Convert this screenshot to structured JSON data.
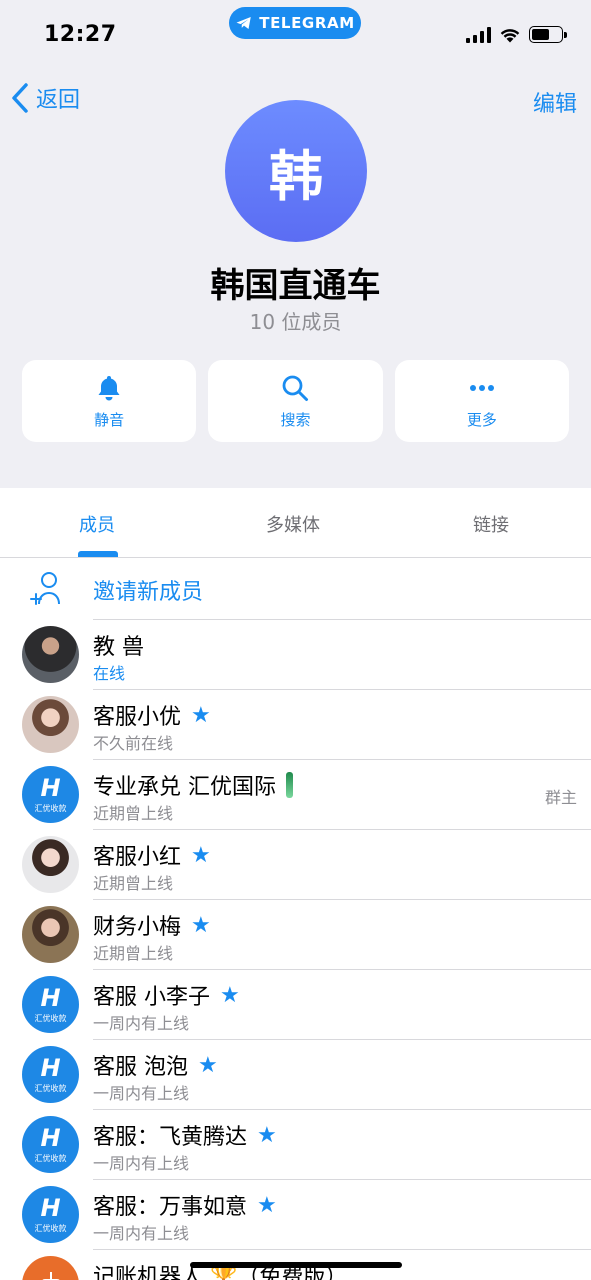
{
  "status": {
    "time": "12:27",
    "app_pill": "TELEGRAM"
  },
  "nav": {
    "back": "返回",
    "edit": "编辑"
  },
  "group": {
    "avatar_letter": "韩",
    "name": "韩国直通车",
    "members": "10 位成员"
  },
  "actions": [
    {
      "label": "静音",
      "icon": "bell-icon"
    },
    {
      "label": "搜索",
      "icon": "search-icon"
    },
    {
      "label": "更多",
      "icon": "more-icon"
    }
  ],
  "tabs": [
    "成员",
    "多媒体",
    "链接"
  ],
  "invite": "邀请新成员",
  "brand_avatar": {
    "letter": "H",
    "text": "汇优收款"
  },
  "members": [
    {
      "name": "教 兽",
      "status": "在线",
      "avatar": "photo-man"
    },
    {
      "name": "客服小优",
      "status": "不久前在线",
      "avatar": "photo-girl1"
    },
    {
      "name": "专业承兑 汇优国际",
      "status": "近期曾上线",
      "avatar": "brand",
      "role": "群主"
    },
    {
      "name": "客服小红",
      "status": "近期曾上线",
      "avatar": "photo-girl2"
    },
    {
      "name": "财务小梅",
      "status": "近期曾上线",
      "avatar": "photo-girl3"
    },
    {
      "name": "客服 小李子",
      "status": "一周内有上线",
      "avatar": "brand"
    },
    {
      "name": "客服 泡泡",
      "status": "一周内有上线",
      "avatar": "brand"
    },
    {
      "name": "客服：飞黄腾达",
      "status": "一周内有上线",
      "avatar": "brand"
    },
    {
      "name": "客服：万事如意",
      "status": "一周内有上线",
      "avatar": "brand"
    },
    {
      "name": "记账机器人 🏆（免费版）",
      "status": "",
      "avatar": "bot"
    }
  ],
  "colors": {
    "accent": "#1a8cf0",
    "header_bg": "#efeff4"
  }
}
